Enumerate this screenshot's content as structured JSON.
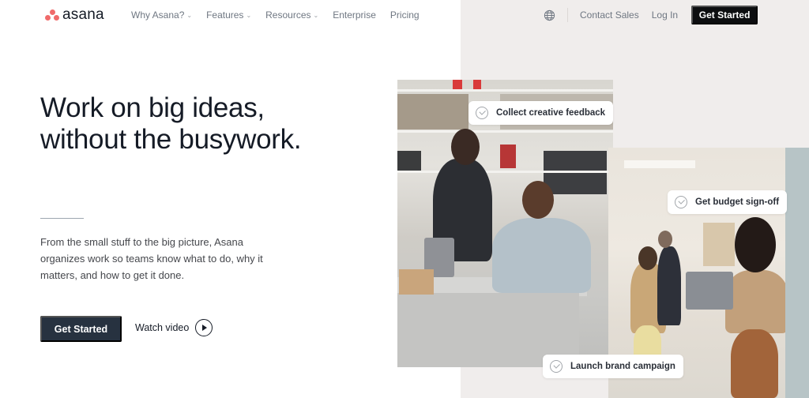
{
  "nav": {
    "logo_text": "asana",
    "links": [
      {
        "label": "Why Asana?",
        "has_dropdown": true
      },
      {
        "label": "Features",
        "has_dropdown": true
      },
      {
        "label": "Resources",
        "has_dropdown": true
      },
      {
        "label": "Enterprise",
        "has_dropdown": false
      },
      {
        "label": "Pricing",
        "has_dropdown": false
      }
    ],
    "language_icon": "globe-icon",
    "contact_sales": "Contact Sales",
    "log_in": "Log In",
    "get_started": "Get Started",
    "chevron_glyph": "⌄"
  },
  "hero": {
    "headline_line1": "Work on big ideas,",
    "headline_line2": "without the busywork.",
    "subtext": "From the small stuff to the big picture, Asana organizes work so teams know what to do, why it matters, and how to get it done.",
    "cta_label": "Get Started",
    "watch_video_label": "Watch video"
  },
  "photos": {
    "chips": [
      {
        "label": "Collect creative feedback"
      },
      {
        "label": "Get budget sign-off"
      },
      {
        "label": "Launch brand campaign"
      }
    ]
  },
  "colors": {
    "brand_coral": "#f06a6a",
    "nav_button": "#0d0e10",
    "hero_button": "#273240",
    "right_background": "#f0edec"
  }
}
